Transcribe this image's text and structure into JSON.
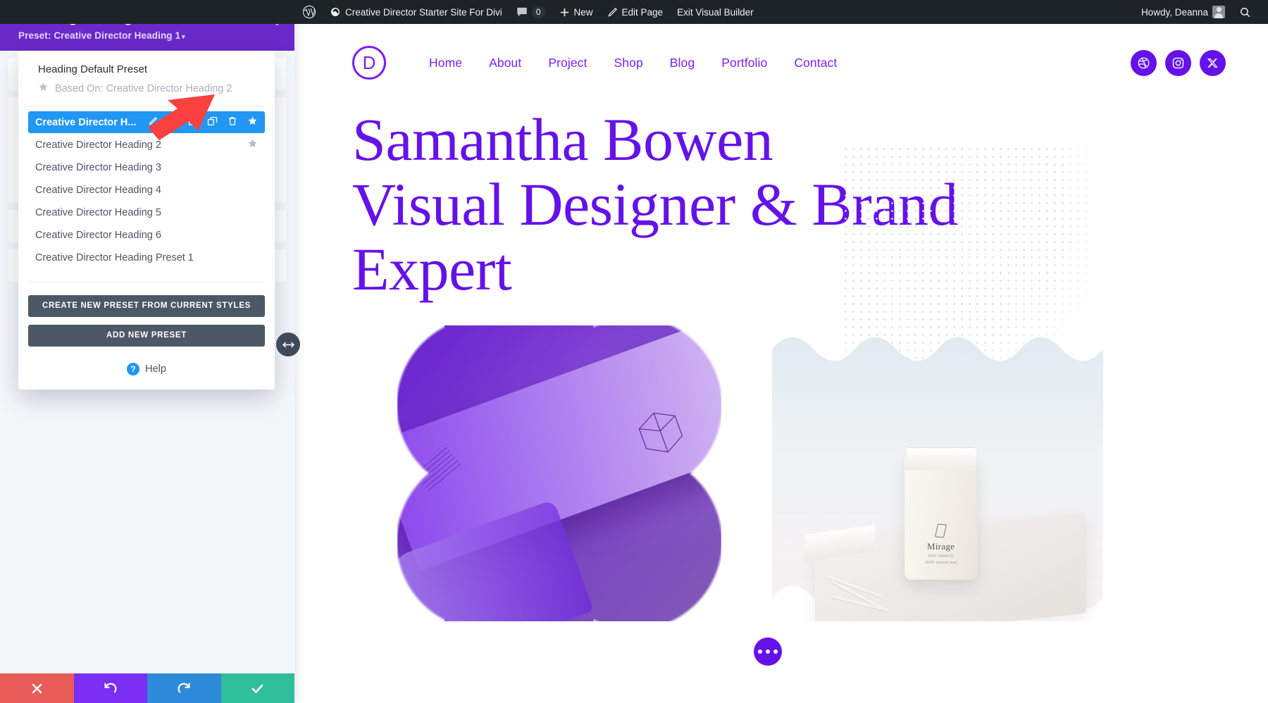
{
  "adminbar": {
    "logo_icon": "wordpress-logo-icon",
    "site_icon": "dashboard-icon",
    "site_name": "Creative Director Starter Site For Divi",
    "comments_icon": "comment-bubble-icon",
    "comments_count": "0",
    "new_icon": "plus-icon",
    "new_label": "New",
    "edit_icon": "pencil-icon",
    "edit_label": "Edit Page",
    "exit_label": "Exit Visual Builder",
    "howdy": "Howdy, Deanna",
    "avatar_icon": "user-avatar-icon",
    "search_icon": "search-icon"
  },
  "site": {
    "logo_letter": "D",
    "nav": [
      {
        "label": "Home"
      },
      {
        "label": "About"
      },
      {
        "label": "Project"
      },
      {
        "label": "Shop"
      },
      {
        "label": "Blog"
      },
      {
        "label": "Portfolio"
      },
      {
        "label": "Contact"
      }
    ],
    "social": [
      {
        "name": "dribbble-icon"
      },
      {
        "name": "instagram-icon"
      },
      {
        "name": "x-twitter-icon"
      }
    ],
    "hero_title_line1": "Samantha Bowen",
    "hero_title_line2": "Visual Designer & Brand",
    "hero_title_line3": "Expert",
    "candle_brand": "Mirage",
    "candle_sub": "SOY CANDLE",
    "candle_sub2": "100% natural wax",
    "fab_icon": "ellipsis-icon",
    "ghost_pill_text": "er",
    "accent_color": "#6512e8",
    "heading_color": "#6512e8"
  },
  "panel": {
    "title": "Heading Settings",
    "preset_prefix": "Preset: ",
    "preset_name": "Creative Director Heading 1",
    "header_icons": [
      {
        "name": "focus-target-icon"
      },
      {
        "name": "layout-columns-icon"
      },
      {
        "name": "vertical-kebab-icon"
      }
    ],
    "accent_color": "#6a29c9",
    "dropdown": {
      "default_preset_title": "Heading Default Preset",
      "based_on_icon": "star-icon",
      "based_on_label": "Based On: Creative Director Heading 2",
      "items": [
        {
          "label": "Creative Director H...",
          "active": true,
          "actions": [
            {
              "name": "rename-pencil-icon"
            },
            {
              "name": "settings-gear-icon"
            },
            {
              "name": "export-upload-icon"
            },
            {
              "name": "duplicate-icon"
            },
            {
              "name": "delete-trash-icon"
            },
            {
              "name": "set-default-star-icon"
            }
          ]
        },
        {
          "label": "Creative Director Heading 2",
          "active": false,
          "favorite": true
        },
        {
          "label": "Creative Director Heading 3",
          "active": false
        },
        {
          "label": "Creative Director Heading 4",
          "active": false
        },
        {
          "label": "Creative Director Heading 5",
          "active": false
        },
        {
          "label": "Creative Director Heading 6",
          "active": false
        },
        {
          "label": "Creative Director Heading Preset 1",
          "active": false
        }
      ],
      "create_button": "CREATE NEW PRESET FROM CURRENT STYLES",
      "add_button": "ADD NEW PRESET",
      "help_label": "Help",
      "help_icon": "question-mark-icon",
      "active_color": "#2196f3",
      "button_color": "#4c5866"
    },
    "footer": [
      {
        "name": "close-x-icon",
        "color": "#e85c58"
      },
      {
        "name": "undo-icon",
        "color": "#7b2ff2"
      },
      {
        "name": "redo-icon",
        "color": "#2d8ad8"
      },
      {
        "name": "save-check-icon",
        "color": "#2fbf9b"
      }
    ],
    "resize_handle_icon": "horizontal-resize-icon"
  },
  "annotation": {
    "name": "red-pointer-arrow",
    "color": "#fb4040"
  }
}
